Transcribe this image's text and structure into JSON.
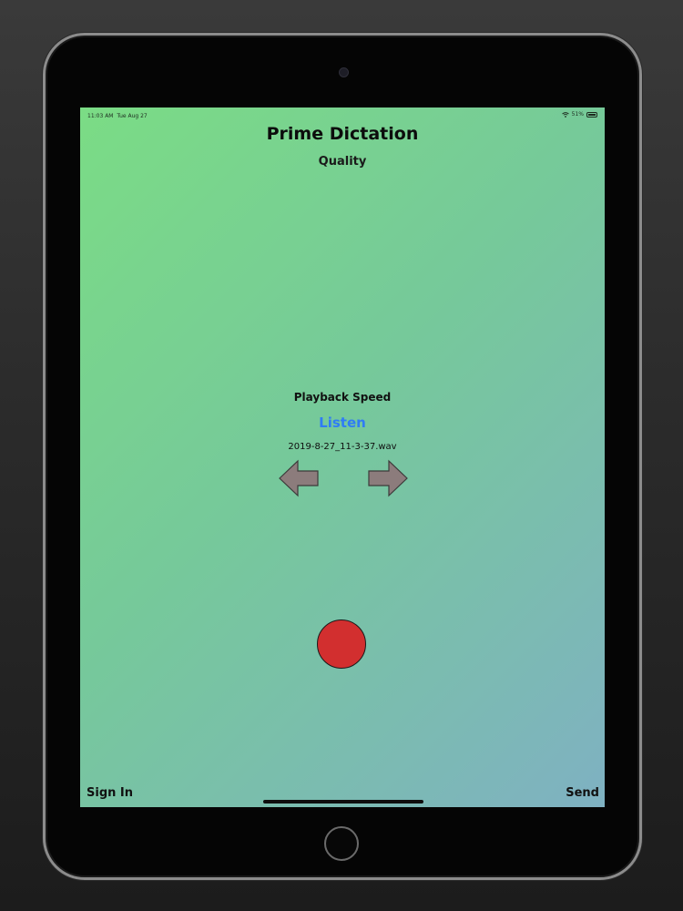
{
  "status_bar": {
    "time": "11:03 AM",
    "date": "Tue Aug 27",
    "battery_percent": "51%",
    "icons": [
      "wifi-icon",
      "battery-icon"
    ]
  },
  "app": {
    "title": "Prime Dictation",
    "quality_label": "Quality",
    "playback_speed_label": "Playback Speed",
    "listen_label": "Listen",
    "filename": "2019-8-27_11-3-37.wav"
  },
  "controls": {
    "previous_icon": "arrow-left-icon",
    "next_icon": "arrow-right-icon",
    "record_icon": "record-icon"
  },
  "footer": {
    "sign_in_label": "Sign In",
    "send_label": "Send"
  },
  "colors": {
    "listen_accent": "#2f7cf5",
    "record_red": "#d22f2f",
    "arrow_gray": "#8c7c7c",
    "gradient_start": "#7bdc85",
    "gradient_end": "#7fb1c2"
  }
}
